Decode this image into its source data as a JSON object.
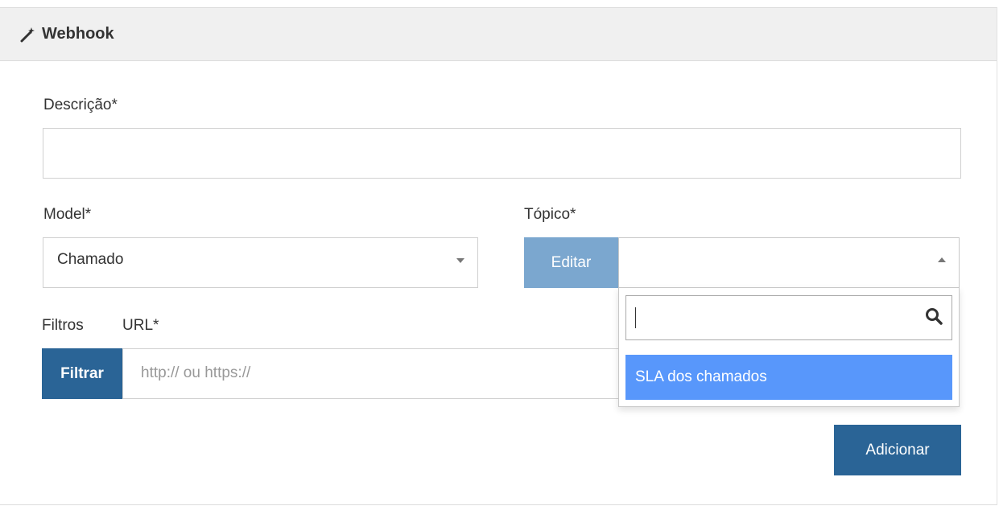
{
  "panel": {
    "title": "Webhook",
    "icon": "magic-wand-icon"
  },
  "form": {
    "descricao": {
      "label": "Descrição*",
      "value": ""
    },
    "model": {
      "label": "Model*",
      "value": "Chamado"
    },
    "topico": {
      "label": "Tópico*",
      "edit_button": "Editar",
      "value": "",
      "dropdown": {
        "search_value": "",
        "options": [
          "SLA dos chamados"
        ]
      }
    },
    "filtros": {
      "label": "Filtros",
      "button": "Filtrar"
    },
    "url": {
      "label": "URL*",
      "placeholder": "http:// ou https://",
      "value": ""
    },
    "submit_button": "Adicionar"
  },
  "colors": {
    "primary": "#2a6496",
    "edit_button": "#7ba7cf",
    "highlight": "#5897fb",
    "header_bg": "#f0f0f0"
  }
}
